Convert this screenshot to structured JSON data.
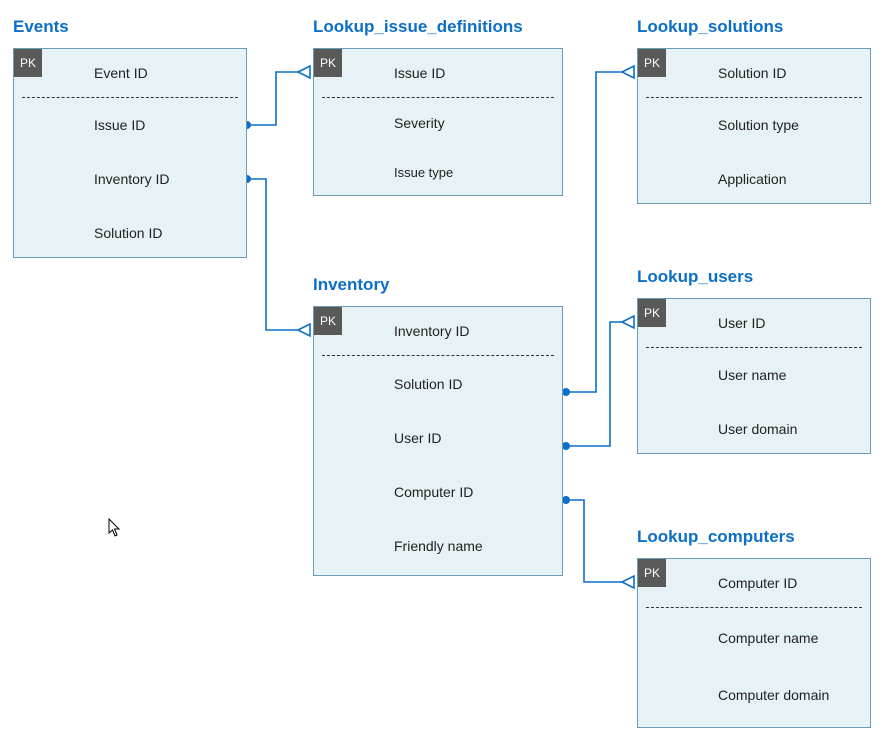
{
  "tables": {
    "events": {
      "title": "Events",
      "pk": "Event ID",
      "fields": [
        "Issue ID",
        "Inventory ID",
        "Solution ID"
      ]
    },
    "issue_defs": {
      "title": "Lookup_issue_definitions",
      "pk": "Issue ID",
      "fields": [
        "Severity",
        "Issue type"
      ]
    },
    "solutions": {
      "title": "Lookup_solutions",
      "pk": "Solution ID",
      "fields": [
        "Solution type",
        "Application"
      ]
    },
    "inventory": {
      "title": "Inventory",
      "pk": "Inventory ID",
      "fields": [
        "Solution ID",
        "User ID",
        "Computer ID",
        "Friendly name"
      ]
    },
    "users": {
      "title": "Lookup_users",
      "pk": "User ID",
      "fields": [
        "User name",
        "User domain"
      ]
    },
    "computers": {
      "title": "Lookup_computers",
      "pk": "Computer ID",
      "fields": [
        "Computer name",
        "Computer domain"
      ]
    }
  },
  "pk_label": "PK",
  "relationships": [
    {
      "from_table": "events",
      "from_field": "Issue ID",
      "to_table": "issue_defs"
    },
    {
      "from_table": "events",
      "from_field": "Inventory ID",
      "to_table": "inventory"
    },
    {
      "from_table": "inventory",
      "from_field": "Solution ID",
      "to_table": "solutions"
    },
    {
      "from_table": "inventory",
      "from_field": "User ID",
      "to_table": "users"
    },
    {
      "from_table": "inventory",
      "from_field": "Computer ID",
      "to_table": "computers"
    }
  ]
}
